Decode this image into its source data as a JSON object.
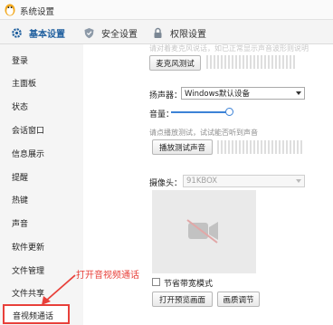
{
  "window": {
    "title": "系统设置"
  },
  "tabs": [
    {
      "label": "基本设置",
      "icon": "gear-icon",
      "active": true
    },
    {
      "label": "安全设置",
      "icon": "shield-icon",
      "active": false
    },
    {
      "label": "权限设置",
      "icon": "lock-icon",
      "active": false
    }
  ],
  "sidebar": {
    "items": [
      {
        "label": "登录"
      },
      {
        "label": "主面板"
      },
      {
        "label": "状态"
      },
      {
        "label": "会话窗口"
      },
      {
        "label": "信息展示"
      },
      {
        "label": "提醒"
      },
      {
        "label": "热键"
      },
      {
        "label": "声音"
      },
      {
        "label": "软件更新"
      },
      {
        "label": "文件管理"
      },
      {
        "label": "文件共享"
      },
      {
        "label": "音视频通话"
      }
    ],
    "selected": "音视频通话"
  },
  "annotation": {
    "text": "打开音视频通话",
    "color": "#e8403a"
  },
  "audio": {
    "truncated_text": "请对着麦克风说话，如已正常显示声音波形则说明",
    "mic_test_button": "麦克风测试",
    "speaker_label": "扬声器：",
    "speaker_value": "Windows默认设备",
    "volume_label": "音量：",
    "volume_level": 1.0,
    "play_hint": "请点播放测试，试试能否听到声音",
    "play_test_button": "播放测试声音"
  },
  "video": {
    "camera_label": "摄像头：",
    "camera_value": "91KBOX",
    "camera_enabled": false,
    "bandwidth_checkbox_label": "节省带宽模式",
    "bandwidth_checked": false,
    "preview_button": "打开预览画面",
    "quality_button": "画质调节"
  },
  "colors": {
    "accent": "#3c82d6",
    "tab_active": "#1f5f9e",
    "annotation": "#e8403a"
  }
}
